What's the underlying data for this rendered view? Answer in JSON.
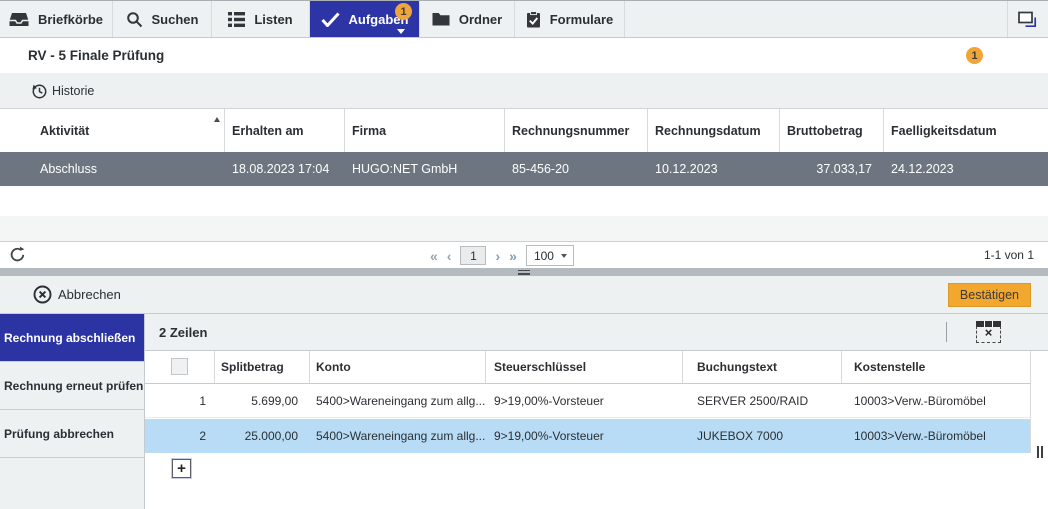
{
  "toolbar": {
    "briefkoerbe": "Briefkörbe",
    "suchen": "Suchen",
    "listen": "Listen",
    "aufgaben": "Aufgaben",
    "aufgaben_badge": "1",
    "ordner": "Ordner",
    "formulare": "Formulare"
  },
  "task_header": {
    "title": "RV - 5 Finale Prüfung",
    "badge": "1"
  },
  "history_bar": {
    "historie": "Historie"
  },
  "task_table": {
    "col_aktivitaet": "Aktivität",
    "col_erhalten": "Erhalten am",
    "col_firma": "Firma",
    "col_rechnungsnummer": "Rechnungsnummer",
    "col_rechnungsdatum": "Rechnungsdatum",
    "col_bruttobetrag": "Bruttobetrag",
    "col_faelligkeit": "Faelligkeitsdatum",
    "rows": [
      {
        "aktivitaet": "Abschluss",
        "erhalten": "18.08.2023 17:04",
        "firma": "HUGO:NET GmbH",
        "rechnungsnummer": "85-456-20",
        "rechnungsdatum": "10.12.2023",
        "bruttobetrag": "37.033,17",
        "faelligkeit": "24.12.2023"
      }
    ]
  },
  "pagination": {
    "first": "«",
    "prev": "‹",
    "page": "1",
    "next": "›",
    "last": "»",
    "page_size": "100",
    "range": "1-1 von 1"
  },
  "action_bar": {
    "abbrechen": "Abbrechen",
    "bestaetigen": "Bestätigen"
  },
  "workflow_menu": {
    "items": [
      {
        "label": "Rechnung abschließen",
        "active": true
      },
      {
        "label": "Rechnung erneut prüfen",
        "active": false
      },
      {
        "label": "Prüfung abbrechen",
        "active": false
      }
    ]
  },
  "split_table": {
    "count": "2 Zeilen",
    "col_splitbetrag": "Splitbetrag",
    "col_konto": "Konto",
    "col_steuerschluessel": "Steuerschlüssel",
    "col_buchungstext": "Buchungstext",
    "col_kostenstelle": "Kostenstelle",
    "rows": [
      {
        "num": "1",
        "splitbetrag": "5.699,00",
        "konto": "5400>Wareneingang zum allg...",
        "steuerschluessel": "9>19,00%-Vorsteuer",
        "buchungstext": "SERVER 2500/RAID",
        "kostenstelle": "10003>Verw.-Büromöbel"
      },
      {
        "num": "2",
        "splitbetrag": "25.000,00",
        "konto": "5400>Wareneingang zum allg...",
        "steuerschluessel": "9>19,00%-Vorsteuer",
        "buchungstext": "JUKEBOX 7000",
        "kostenstelle": "10003>Verw.-Büromöbel"
      }
    ],
    "add_button": "+",
    "tablex_glyph": "×"
  },
  "colors": {
    "accent_blue": "#2d35a6",
    "accent_orange": "#f2a72e",
    "selected_row_gray": "#6d7680",
    "selected_row_blue": "#b8dcf5",
    "bar_gray": "#eef1f2"
  }
}
